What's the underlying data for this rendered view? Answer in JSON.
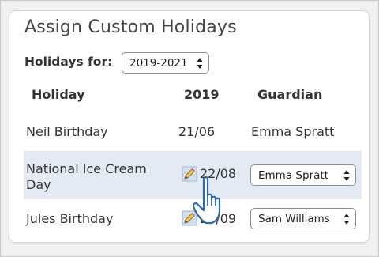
{
  "title": "Assign Custom Holidays",
  "filter": {
    "label": "Holidays for:",
    "selected": "2019-2021"
  },
  "table": {
    "columns": [
      "Holiday",
      "2019",
      "Guardian"
    ],
    "rows": [
      {
        "holiday": "Neil Birthday",
        "date": "21/06",
        "guardian": "Emma Spratt",
        "guardian_editable": false
      },
      {
        "holiday": "National Ice Cream Day",
        "date": "22/08",
        "guardian": "Emma Spratt",
        "guardian_editable": true
      },
      {
        "holiday": "Jules Birthday",
        "date": "25/09",
        "guardian": "Sam Williams",
        "guardian_editable": true
      }
    ]
  },
  "icons": {
    "edit": "pencil-edit-icon",
    "cursor": "pointer-hand-cursor-icon",
    "select_arrows": "updown-arrows-icon"
  },
  "colors": {
    "highlight_row": "#e3eaf3",
    "card_bg": "#ffffff",
    "page_bg": "#f1f1f1",
    "text": "#333333"
  }
}
